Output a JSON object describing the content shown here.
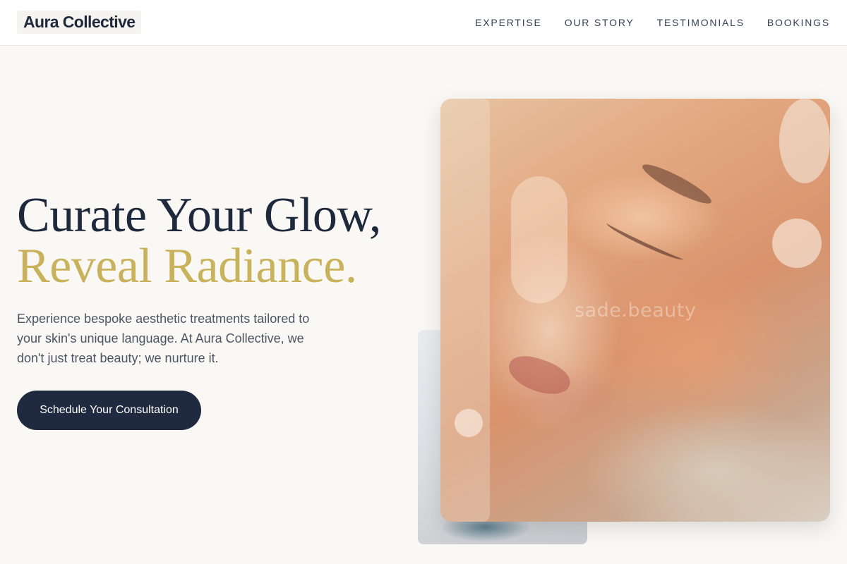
{
  "brand": {
    "name": "Aura Collective"
  },
  "nav": {
    "items": [
      {
        "label": "EXPERTISE"
      },
      {
        "label": "OUR STORY"
      },
      {
        "label": "TESTIMONIALS"
      },
      {
        "label": "BOOKINGS"
      }
    ]
  },
  "hero": {
    "title_line1": "Curate Your Glow,",
    "title_line2": "Reveal Radiance.",
    "description": "Experience bespoke aesthetic treatments tailored to your skin's unique language. At Aura Collective, we don't just treat beauty; we nurture it.",
    "cta_label": "Schedule Your Consultation"
  },
  "images": {
    "main_watermark": "sade.beauty"
  },
  "colors": {
    "navy": "#1f2a40",
    "gold": "#c9b25c",
    "background": "#faf8f5"
  }
}
